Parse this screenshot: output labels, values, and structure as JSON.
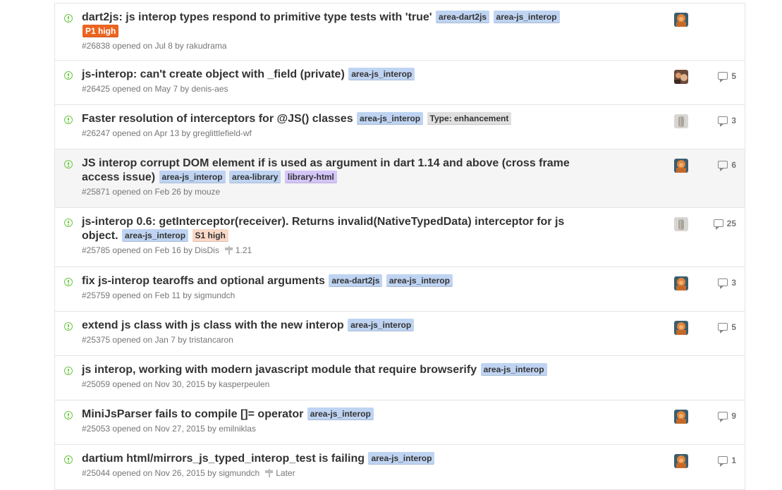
{
  "colors": {
    "open_icon": "#6cc644",
    "label_area": "#bfd4f2",
    "label_p1": "#eb6420",
    "label_s1": "#fad8c7",
    "label_enhancement": "#e0e0e0",
    "label_library_html": "#d4c5f9",
    "row_highlight": "#f5f5f5"
  },
  "issues": [
    {
      "title": "dart2js: js interop types respond to primitive type tests with 'true'",
      "labels": [
        {
          "text": "area-dart2js",
          "bg": "#bfd4f2",
          "fg": "#333333"
        },
        {
          "text": "area-js_interop",
          "bg": "#bfd4f2",
          "fg": "#333333"
        },
        {
          "text": "P1 high",
          "bg": "#eb6420",
          "fg": "#ffffff"
        }
      ],
      "number": "#26838",
      "opened": "opened on Jul 8 by",
      "author": "rakudrama",
      "milestone": "",
      "avatar": "orange",
      "comments": ""
    },
    {
      "title": "js-interop: can't create object with _field (private)",
      "labels": [
        {
          "text": "area-js_interop",
          "bg": "#bfd4f2",
          "fg": "#333333"
        }
      ],
      "number": "#26425",
      "opened": "opened on May 7 by",
      "author": "denis-aes",
      "milestone": "",
      "avatar": "mixed",
      "comments": "5"
    },
    {
      "title": "Faster resolution of interceptors for @JS() classes",
      "labels": [
        {
          "text": "area-js_interop",
          "bg": "#bfd4f2",
          "fg": "#333333"
        },
        {
          "text": "Type: enhancement",
          "bg": "#e0e0e0",
          "fg": "#333333"
        }
      ],
      "number": "#26247",
      "opened": "opened on Apr 13 by",
      "author": "greglittlefield-wf",
      "milestone": "",
      "avatar": "gray",
      "comments": "3"
    },
    {
      "title": "JS interop corrupt DOM element if is used as argument in dart 1.14 and above (cross frame access issue)",
      "labels": [
        {
          "text": "area-js_interop",
          "bg": "#bfd4f2",
          "fg": "#333333"
        },
        {
          "text": "area-library",
          "bg": "#bfd4f2",
          "fg": "#333333"
        },
        {
          "text": "library-html",
          "bg": "#d4c5f9",
          "fg": "#333333"
        }
      ],
      "number": "#25871",
      "opened": "opened on Feb 26 by",
      "author": "mouze",
      "milestone": "",
      "avatar": "orange",
      "comments": "6",
      "highlight": true
    },
    {
      "title": "js-interop 0.6: getInterceptor(receiver). Returns invalid(NativeTypedData) interceptor for js object.",
      "labels": [
        {
          "text": "area-js_interop",
          "bg": "#bfd4f2",
          "fg": "#333333"
        },
        {
          "text": "S1 high",
          "bg": "#fad8c7",
          "fg": "#333333"
        }
      ],
      "number": "#25785",
      "opened": "opened on Feb 16 by",
      "author": "DisDis",
      "milestone": "1.21",
      "avatar": "gray",
      "comments": "25"
    },
    {
      "title": "fix js-interop tearoffs and optional arguments",
      "labels": [
        {
          "text": "area-dart2js",
          "bg": "#bfd4f2",
          "fg": "#333333"
        },
        {
          "text": "area-js_interop",
          "bg": "#bfd4f2",
          "fg": "#333333"
        }
      ],
      "number": "#25759",
      "opened": "opened on Feb 11 by",
      "author": "sigmundch",
      "milestone": "",
      "avatar": "orange",
      "comments": "3"
    },
    {
      "title": "extend js class with js class with the new interop",
      "labels": [
        {
          "text": "area-js_interop",
          "bg": "#bfd4f2",
          "fg": "#333333"
        }
      ],
      "number": "#25375",
      "opened": "opened on Jan 7 by",
      "author": "tristancaron",
      "milestone": "",
      "avatar": "orange",
      "comments": "5"
    },
    {
      "title": "js interop, working with modern javascript module that require browserify",
      "labels": [
        {
          "text": "area-js_interop",
          "bg": "#bfd4f2",
          "fg": "#333333"
        }
      ],
      "number": "#25059",
      "opened": "opened on Nov 30, 2015 by",
      "author": "kasperpeulen",
      "milestone": "",
      "avatar": "",
      "comments": ""
    },
    {
      "title": "MiniJsParser fails to compile []= operator",
      "labels": [
        {
          "text": "area-js_interop",
          "bg": "#bfd4f2",
          "fg": "#333333"
        }
      ],
      "number": "#25053",
      "opened": "opened on Nov 27, 2015 by",
      "author": "emilniklas",
      "milestone": "",
      "avatar": "orange",
      "comments": "9"
    },
    {
      "title": "dartium html/mirrors_js_typed_interop_test is failing",
      "labels": [
        {
          "text": "area-js_interop",
          "bg": "#bfd4f2",
          "fg": "#333333"
        }
      ],
      "number": "#25044",
      "opened": "opened on Nov 26, 2015 by",
      "author": "sigmundch",
      "milestone": "Later",
      "avatar": "orange",
      "comments": "1"
    }
  ]
}
